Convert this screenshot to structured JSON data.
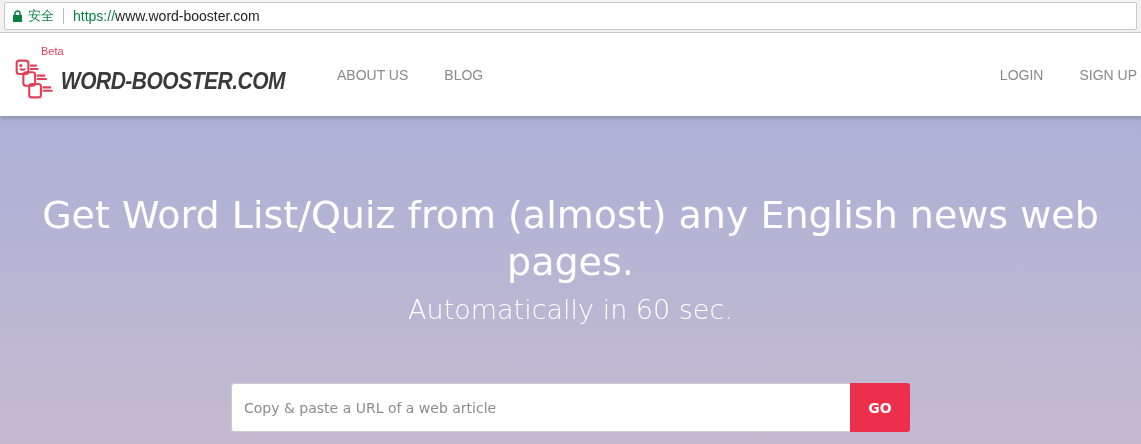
{
  "browser": {
    "security_label": "安全",
    "url": {
      "scheme": "https://",
      "host": "www.word-booster.com"
    }
  },
  "header": {
    "logo": {
      "badge": "Beta",
      "wordmark": "WORD-BOOSTER.COM"
    },
    "nav_left": [
      "ABOUT US",
      "BLOG"
    ],
    "nav_right": [
      "LOGIN",
      "SIGN UP"
    ]
  },
  "hero": {
    "title": "Get Word List/Quiz from (almost) any English news web pages.",
    "subtitle": "Automatically in 60 sec.",
    "search": {
      "placeholder": "Copy & paste a URL of a web article",
      "button": "GO"
    }
  }
}
